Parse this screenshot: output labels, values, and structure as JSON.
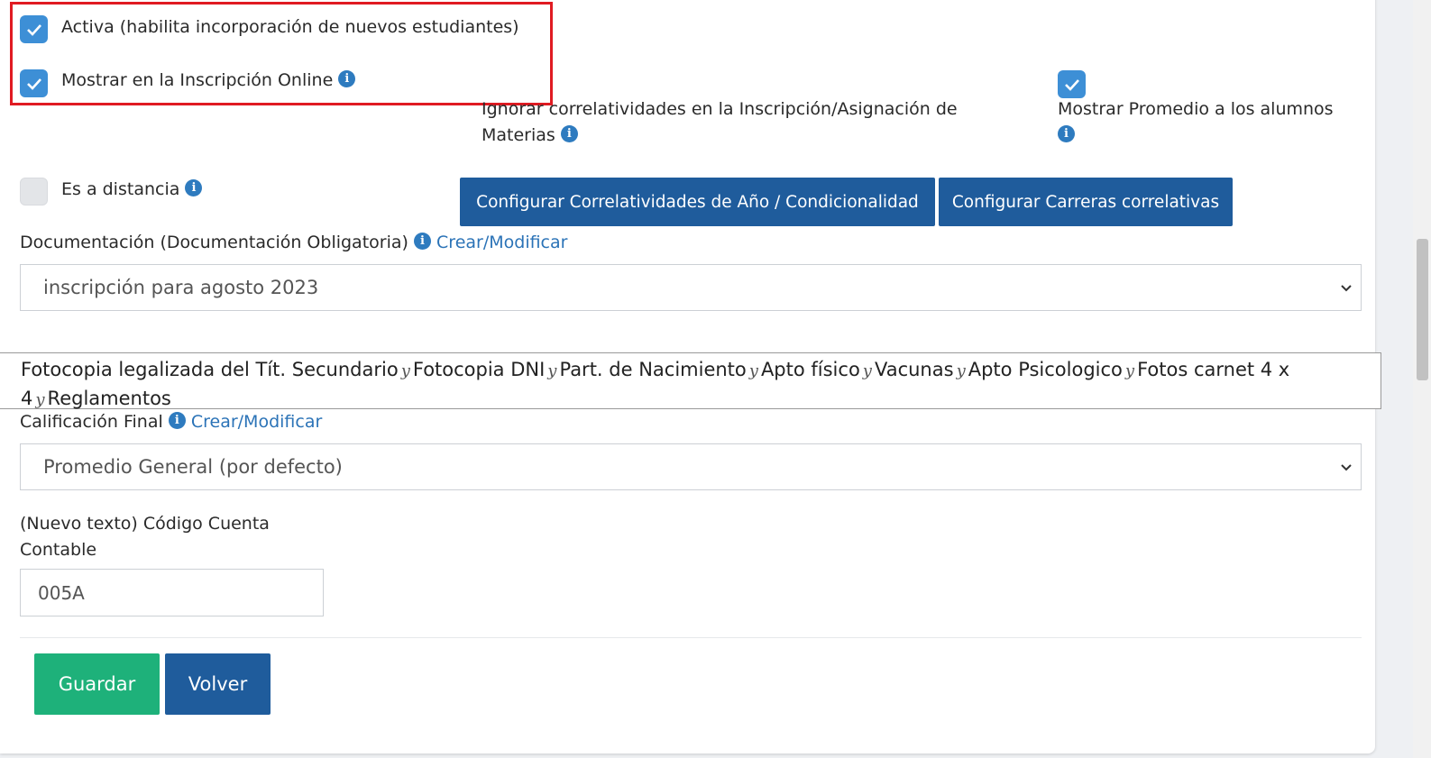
{
  "checks": {
    "activa_label": "Activa (habilita incorporación de nuevos estudiantes)",
    "mostrar_label": "Mostrar en la Inscripción Online",
    "ignorar_label_line1": "Ignorar correlatividades en la Inscripción/Asignación de",
    "ignorar_label_line2": "Materias",
    "promedio_label": "Mostrar Promedio a los alumnos",
    "distancia_label": "Es a distancia"
  },
  "buttons": {
    "config_correlatividades": "Configurar Correlatividades de Año / Condicionalidad",
    "config_carreras": "Configurar Carreras correlativas",
    "guardar": "Guardar",
    "volver": "Volver"
  },
  "documentacion": {
    "label": "Documentación (Documentación Obligatoria)",
    "link": "Crear/Modificar",
    "selected": "inscripción para agosto 2023",
    "items": [
      "Fotocopia legalizada del Tít. Secundario",
      "Fotocopia DNI",
      "Part. de Nacimiento",
      "Apto físico",
      "Vacunas",
      "Apto Psicologico",
      "Fotos carnet 4 x 4",
      "Reglamentos"
    ],
    "separator": "y"
  },
  "calificacion": {
    "label": "Calificación Final",
    "link": "Crear/Modificar",
    "selected": "Promedio General (por defecto)"
  },
  "codigo": {
    "label_line1": "(Nuevo texto) Código Cuenta",
    "label_line2": "Contable",
    "value": "005A"
  },
  "icons": {
    "info": "i",
    "check": "checkmark-icon",
    "chevron": "chevron-down-icon"
  },
  "colors": {
    "highlight": "#e01b22",
    "primary": "#1f5c9c",
    "success": "#1eb17a",
    "link": "#2b73b7"
  }
}
